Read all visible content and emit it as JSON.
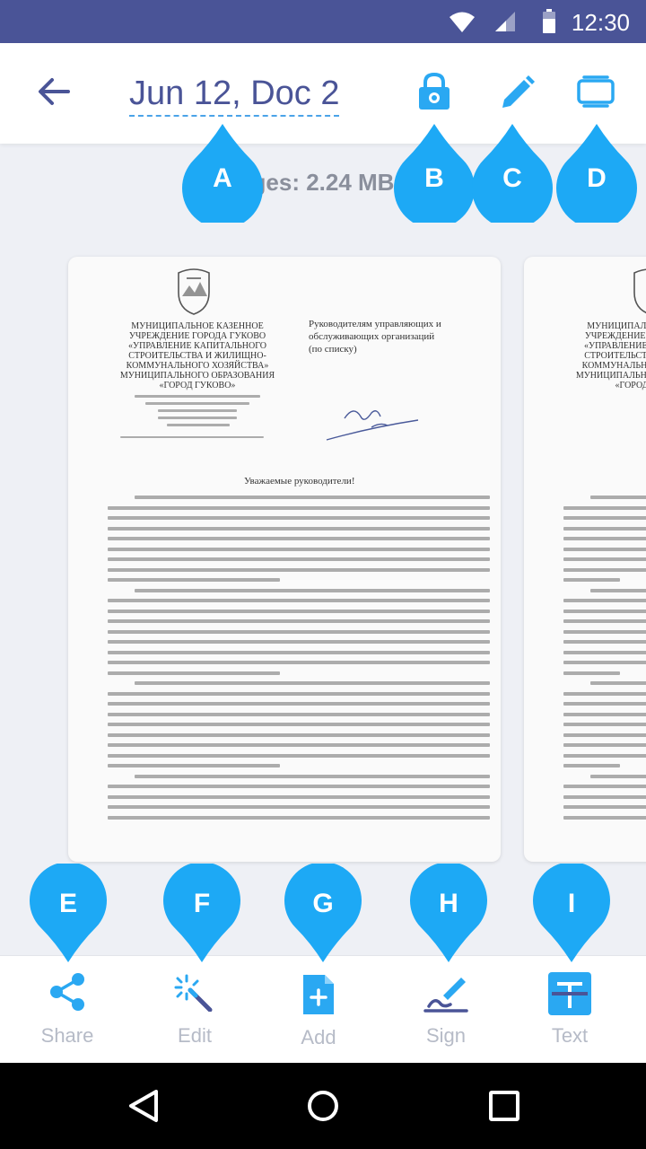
{
  "status_bar": {
    "time": "12:30"
  },
  "app_bar": {
    "title": "Jun 12, Doc 2"
  },
  "pages_info": "ges: 2.24 MB",
  "document": {
    "header_left": [
      "МУНИЦИПАЛЬНОЕ КАЗЕННОЕ",
      "УЧРЕЖДЕНИЕ ГОРОДА ГУКОВО",
      "«УПРАВЛЕНИЕ КАПИТАЛЬНОГО",
      "СТРОИТЕЛЬСТВА И ЖИЛИЩНО-",
      "КОММУНАЛЬНОГО ХОЗЯЙСТВА»",
      "МУНИЦИПАЛЬНОГО ОБРАЗОВАНИЯ",
      "«ГОРОД ГУКОВО»"
    ],
    "header_right": [
      "Руководителям управляющих и",
      "обслуживающих организаций",
      "(по списку)"
    ],
    "greeting": "Уважаемые руководители!"
  },
  "bottom_bar": {
    "share": "Share",
    "edit": "Edit",
    "add": "Add",
    "sign": "Sign",
    "text": "Text"
  },
  "callouts": [
    "A",
    "B",
    "C",
    "D",
    "E",
    "F",
    "G",
    "H",
    "I"
  ],
  "colors": {
    "accent": "#2aa8f2",
    "brand": "#4a5497",
    "pin": "#1da9f5"
  }
}
